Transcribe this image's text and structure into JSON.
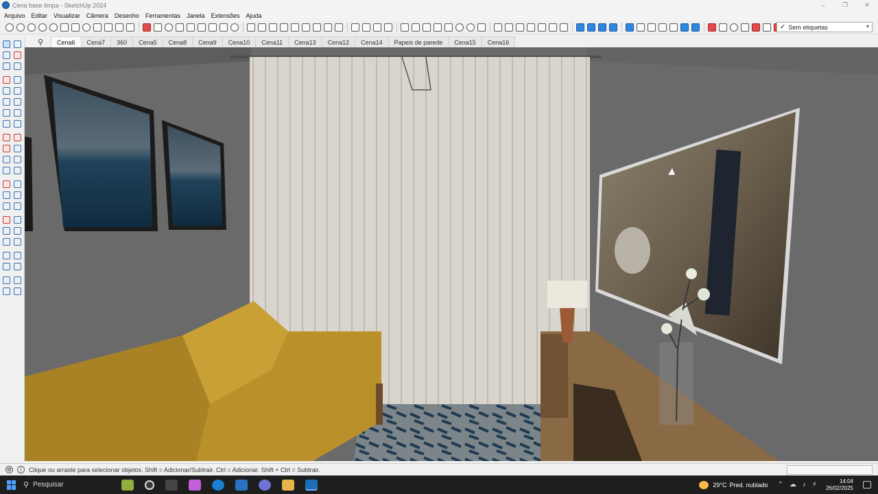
{
  "window": {
    "title": "Cena base limpa - SketchUp 2024",
    "minimize": "–",
    "maximize": "❐",
    "close": "✕"
  },
  "menu": [
    "Arquivo",
    "Editar",
    "Visualizar",
    "Câmera",
    "Desenho",
    "Ferramentas",
    "Janela",
    "Extensões",
    "Ajuda"
  ],
  "tag_dropdown": {
    "check": "✓",
    "value": "Sem etiquetas",
    "chevron": "▾"
  },
  "scene_tabs": {
    "search_icon": "⚲",
    "tabs": [
      "Cena6",
      "Cena7",
      "360",
      "Cena5",
      "Cena8",
      "Cena9",
      "Cena10",
      "Cena11",
      "Cena13",
      "Cena12",
      "Cena14",
      "Papeis de parede",
      "Cena15",
      "Cena16"
    ],
    "active": "Cena6"
  },
  "status": {
    "text": "Clique ou arraste para selecionar objetos. Shift = Adicionar/Subtrair. Ctrl = Adicionar. Shift + Ctrl = Subtrair.",
    "icon1": "⚙",
    "icon2": "i"
  },
  "taskbar": {
    "search_placeholder": "Pesquisar",
    "search_icon": "⚲",
    "weather_temp": "29°C",
    "weather_desc": "Pred. nublado",
    "time": "14:04",
    "date": "26/02/2025",
    "tray_icons": [
      "⌃",
      "☁",
      "♪",
      "⚡"
    ]
  },
  "colors": {
    "wall": "#6c6c6c",
    "curtain": "#d9d5cc",
    "sofa": "#b9902a",
    "cabinet": "#8a6a44",
    "tv_frame": "#cfcfcf",
    "lamp_base": "#9a5a35",
    "rug": "#2f4658"
  }
}
